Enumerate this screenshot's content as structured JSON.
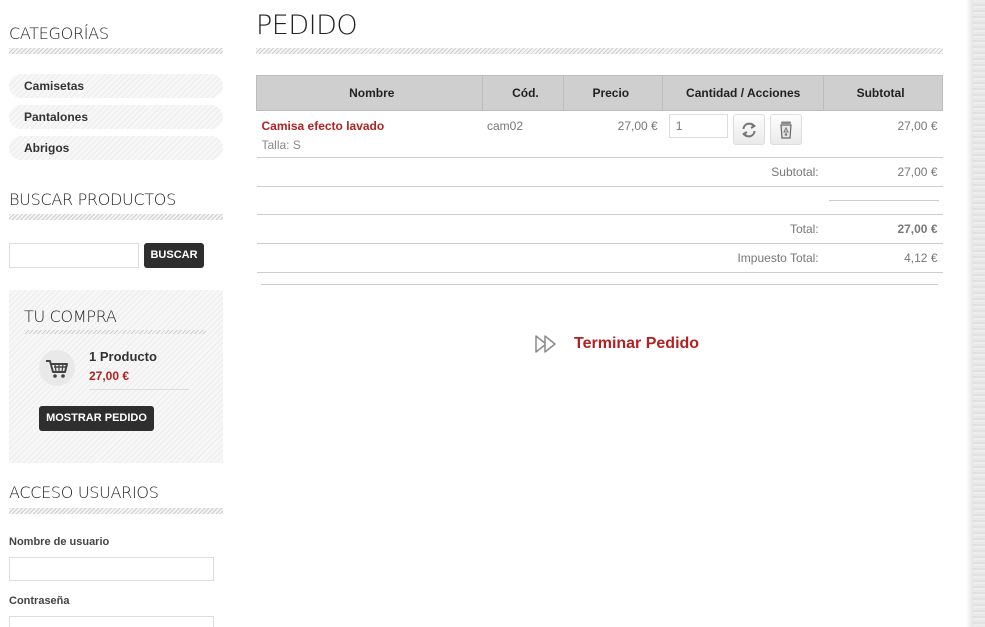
{
  "sidebar": {
    "categories": {
      "title": "CATEGORÍAS",
      "items": [
        {
          "label": "Camisetas"
        },
        {
          "label": "Pantalones"
        },
        {
          "label": "Abrigos"
        }
      ]
    },
    "search": {
      "title": "BUSCAR PRODUCTOS",
      "placeholder": "",
      "button_label": "BUSCAR"
    },
    "cart": {
      "title": "TU COMPRA",
      "count": "1 Producto",
      "total": "27,00 €",
      "button_label": "MOSTRAR PEDIDO"
    },
    "login": {
      "title": "ACCESO USUARIOS",
      "username_label": "Nombre de usuario",
      "password_label": "Contraseña"
    }
  },
  "main": {
    "title": "PEDIDO",
    "table": {
      "headers": [
        "Nombre",
        "Cód.",
        "Precio",
        "Cantidad / Acciones",
        "Subtotal"
      ],
      "rows": [
        {
          "name": "Camisa efecto lavado",
          "variant": "Talla: S",
          "code": "cam02",
          "price": "27,00 €",
          "quantity": "1",
          "subtotal": "27,00 €"
        }
      ]
    },
    "summary": {
      "subtotal_label": "Subtotal:",
      "subtotal_value": "27,00 €",
      "total_label": "Total:",
      "total_value": "27,00 €",
      "tax_label": "Impuesto Total:",
      "tax_value": "4,12 €"
    },
    "checkout_label": "Terminar Pedido"
  },
  "colors": {
    "accent_red": "#b22222",
    "button_dark": "#2e2e2e",
    "header_gray": "#cfcfcf"
  },
  "icons": [
    "cart-icon",
    "refresh-icon",
    "trash-icon",
    "fast-forward-icon"
  ]
}
